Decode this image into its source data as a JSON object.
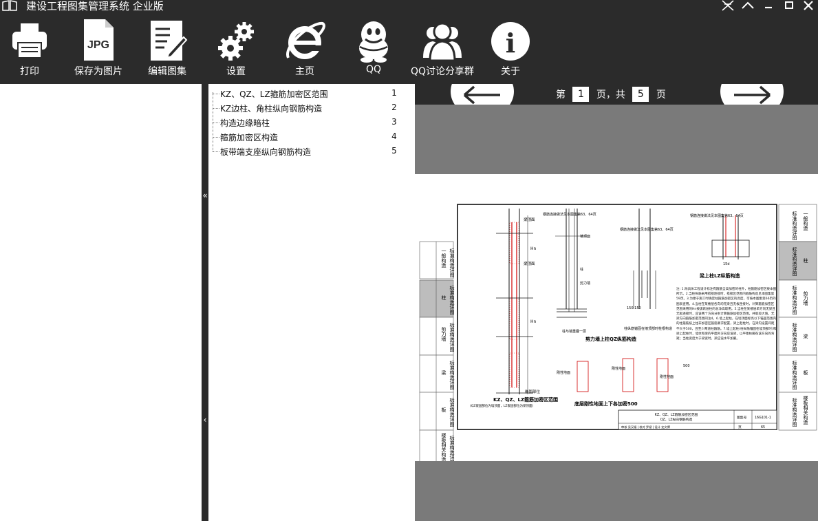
{
  "window": {
    "title": "建设工程图集管理系统  企业版",
    "controls": [
      "pin-icon",
      "collapse-icon",
      "minimize-icon",
      "maximize-icon",
      "close-icon"
    ]
  },
  "toolbar": {
    "items": [
      {
        "label": "打印",
        "icon": "printer-icon"
      },
      {
        "label": "保存为图片",
        "icon": "jpg-file-icon",
        "icon_text": "JPG"
      },
      {
        "label": "编辑图集",
        "icon": "edit-document-icon"
      },
      {
        "label": "设置",
        "icon": "gears-icon"
      },
      {
        "label": "主页",
        "icon": "ie-browser-icon"
      },
      {
        "label": "QQ",
        "icon": "qq-penguin-icon"
      },
      {
        "label": "QQ讨论分享群",
        "icon": "group-users-icon"
      },
      {
        "label": "关于",
        "icon": "info-icon",
        "icon_text": "i"
      }
    ]
  },
  "splitter": {
    "collapse_glyph": "«",
    "collapse_glyph_2": "‹"
  },
  "toc": {
    "items": [
      {
        "title": "KZ、QZ、LZ箍筋加密区范围",
        "page": "1"
      },
      {
        "title": "KZ边柱、角柱纵向钢筋构造",
        "page": "2"
      },
      {
        "title": "构造边缘暗柱",
        "page": "3"
      },
      {
        "title": "箍筋加密区构造",
        "page": "4"
      },
      {
        "title": "板带端支座纵向钢筋构造",
        "page": "5"
      }
    ]
  },
  "viewer": {
    "page_prefix": "第",
    "current_page": "1",
    "page_mid": "页，共",
    "total_pages": "5",
    "page_suffix": "页"
  },
  "drawing": {
    "left_tabs": [
      {
        "head": "标准构造详图",
        "name": "一般构造"
      },
      {
        "head": "标准构造详图",
        "name": "柱"
      },
      {
        "head": "标准构造详图",
        "name": "剪力墙"
      },
      {
        "head": "标准构造详图",
        "name": "梁"
      },
      {
        "head": "标准构造详图",
        "name": "板"
      },
      {
        "head": "标准构造详图",
        "name": "楼板相关构造"
      }
    ],
    "right_tabs": [
      {
        "head": "标准构造详图",
        "name": "一般构造"
      },
      {
        "head": "标准构造详图",
        "name": "柱"
      },
      {
        "head": "标准构造详图",
        "name": "剪力墙"
      },
      {
        "head": "标准构造详图",
        "name": "梁"
      },
      {
        "head": "标准构造详图",
        "name": "板"
      },
      {
        "head": "标准构造详图",
        "name": "楼板相关构造"
      }
    ],
    "captions": {
      "kz_title": "KZ、QZ、LZ箍筋加密区范围",
      "kz_sub": "(QZ嵌固部位为墙顶面，LZ嵌固部位为梁顶面)",
      "shear_wall_title": "剪力墙上柱QZ纵筋构造",
      "beam_column_title": "梁上柱LZ纵筋构造",
      "ground_title": "底层刚性地面上下各加密500",
      "col_on_wall": "柱与墙重叠一层",
      "anchor_top": "柱纵筋锚固在墙顶部时柱根构造",
      "rebar_note": "钢筋连接做法见本图集第63、64页",
      "rebar_note_2": "钢筋连接做法见本图集第63、64页",
      "rebar_note_3": "钢筋连接做法见本图集第63、64页",
      "beam_top": "梁顶面",
      "wall_top": "墙顶面",
      "shear_wall": "剪力墙",
      "col": "柱",
      "rigid_ground": "刚性地面",
      "rigid_ground_2": "刚性地面",
      "rigid_ground_3": "刚性地面",
      "embed": "嵌固部位",
      "dim_150": "150 150",
      "dim_500": "500",
      "dim_15d": "15d",
      "dim_hn": "Hn"
    },
    "notes": "注: 1.除具体工程设计标注有箍筋全高加密的柱外，柱箍筋加密区按本图所示。2.当柱纵筋采用搭接连接时，搭接区范围内箍筋构造见本图集第59页。3.为便于施工时确定柱箍筋加密区的高度，可按本图集第66页的图表查用。4.当柱在某楼层各向均无梁且无板连接时，计算箍筋加密区范围采用的Hn按该跃层柱的总净高取用。5.当柱在某楼层单方向无梁且无板连接时，应该两个方向分别计算箍筋加密区范围，并取较大值，无梁方向箍筋加密范围同注4。6.墙上起柱，在墙顶面标高以下锚固范围内的柱箍筋按上柱非加密区箍筋要求配置，梁上起柱时，在梁内设置间距不大于500，且至少两道柱箍筋。7.墙上起柱(柱纵筋锚固在墙顶部时)和梁上起柱时，墙体和梁的平面外方向应设梁，以平衡柱脚在该方向的弯矩；当柱宽度大于梁宽时，梁应设水平加腋。",
    "title_block": {
      "name_line1": "KZ、QZ、LZ箍筋加密区范围",
      "name_line2": "QZ、LZ纵向钢筋构造",
      "atlas_label": "图集号",
      "atlas_no": "16G101-1",
      "review_row": "审核 吴汉福 | 校对 罗斌 | 设计 史文博",
      "page_label": "页",
      "page_no": "65"
    }
  }
}
